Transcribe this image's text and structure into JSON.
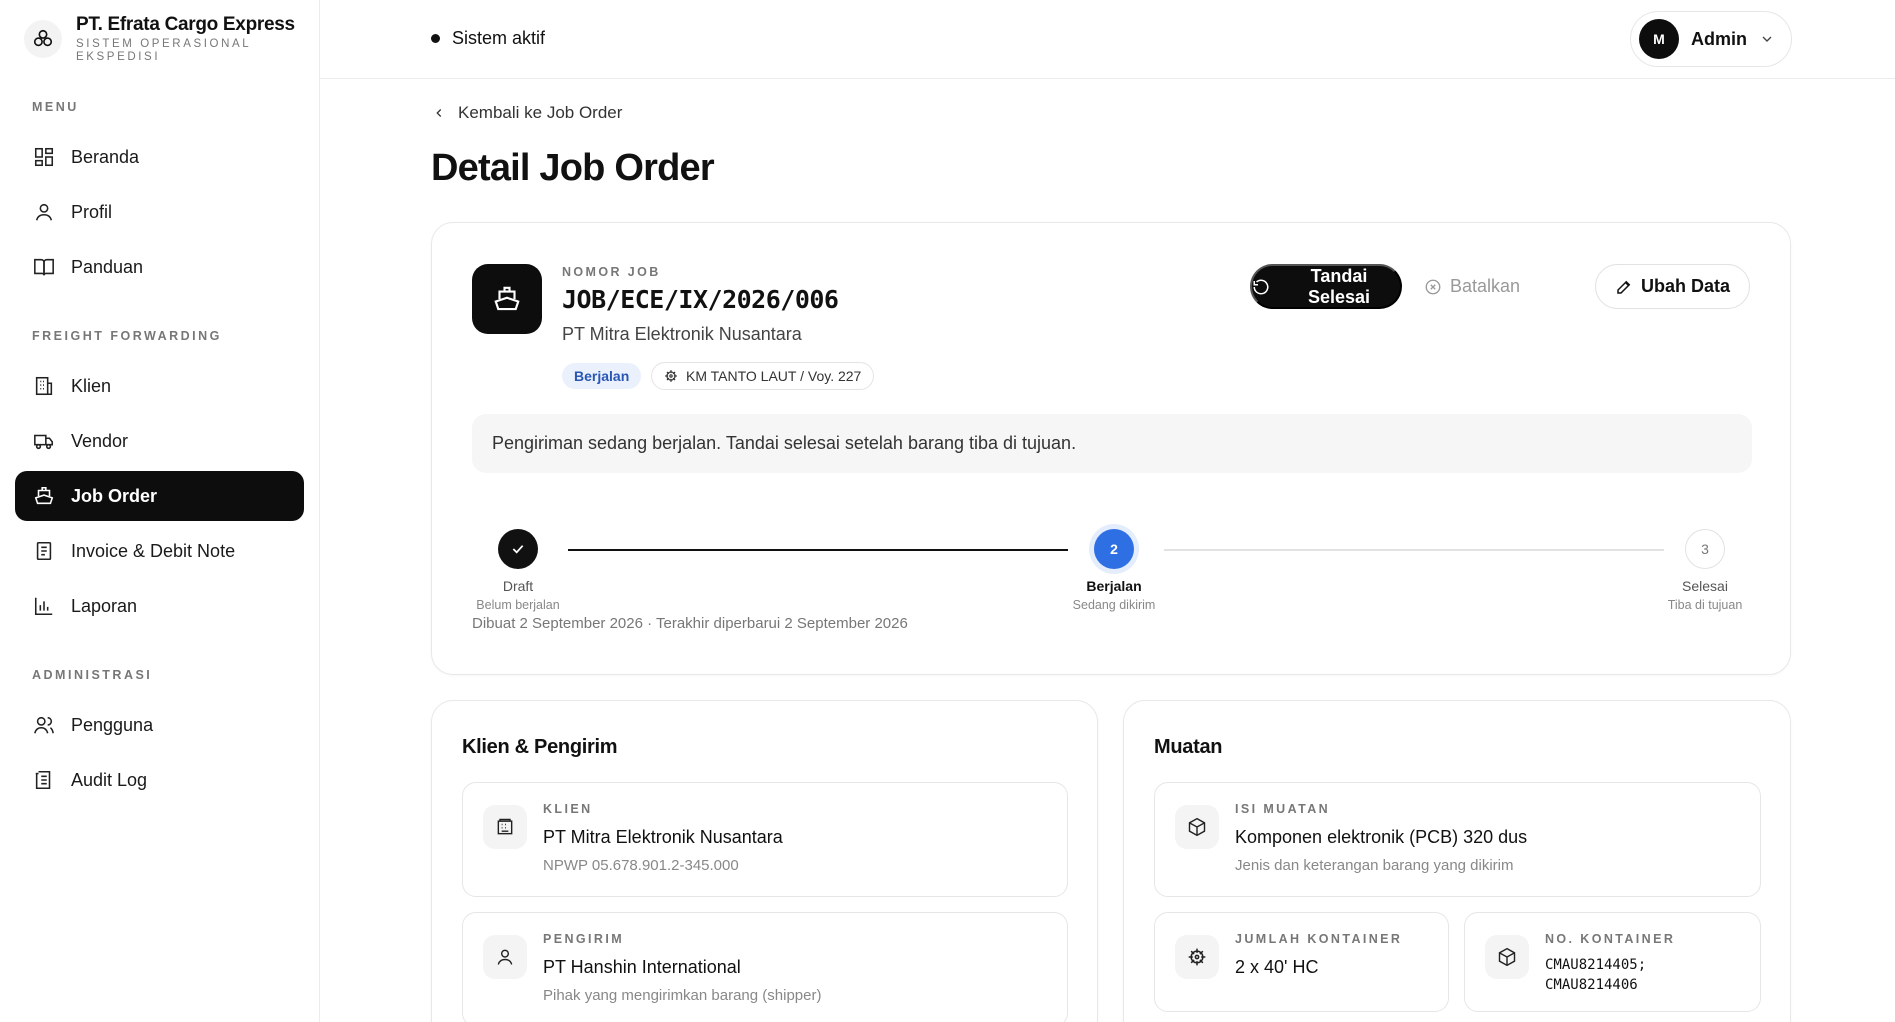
{
  "brand": {
    "name": "PT. Efrata Cargo Express",
    "subtitle": "SISTEM OPERASIONAL EKSPEDISI"
  },
  "sidebar": {
    "sections": [
      {
        "label": "MENU"
      },
      {
        "label": "FREIGHT FORWARDING"
      },
      {
        "label": "ADMINISTRASI"
      }
    ],
    "items": [
      {
        "label": "Beranda",
        "icon": "dashboard-icon"
      },
      {
        "label": "Profil",
        "icon": "user-icon"
      },
      {
        "label": "Panduan",
        "icon": "book-icon"
      },
      {
        "label": "Klien",
        "icon": "building-icon"
      },
      {
        "label": "Vendor",
        "icon": "truck-icon"
      },
      {
        "label": "Job Order",
        "icon": "ship-icon",
        "active": true
      },
      {
        "label": "Invoice & Debit Note",
        "icon": "document-icon"
      },
      {
        "label": "Laporan",
        "icon": "chart-icon"
      },
      {
        "label": "Pengguna",
        "icon": "users-icon"
      },
      {
        "label": "Audit Log",
        "icon": "log-icon"
      }
    ]
  },
  "topbar": {
    "status": "Sistem aktif",
    "user": {
      "initial": "M",
      "name": "Admin"
    }
  },
  "page": {
    "back_label": "Kembali ke Job Order",
    "title": "Detail Job Order"
  },
  "job": {
    "number_label": "NOMOR JOB",
    "number": "JOB/ECE/IX/2026/006",
    "client": "PT Mitra Elektronik Nusantara",
    "status_badge": "Berjalan",
    "vessel": "KM TANTO LAUT / Voy. 227",
    "actions": {
      "complete": "Tandai Selesai",
      "cancel": "Batalkan",
      "edit": "Ubah Data"
    },
    "notice": "Pengiriman sedang berjalan. Tandai selesai setelah barang tiba di tujuan.",
    "steps": [
      {
        "number": "1",
        "title": "Draft",
        "subtitle": "Belum berjalan",
        "state": "done"
      },
      {
        "number": "2",
        "title": "Berjalan",
        "subtitle": "Sedang dikirim",
        "state": "current"
      },
      {
        "number": "3",
        "title": "Selesai",
        "subtitle": "Tiba di tujuan",
        "state": "pending"
      }
    ],
    "meta": "Dibuat 2 September 2026 · Terakhir diperbarui 2 September 2026"
  },
  "client_section": {
    "title": "Klien & Pengirim",
    "client": {
      "label": "KLIEN",
      "value": "PT Mitra Elektronik Nusantara",
      "sub": "NPWP 05.678.901.2-345.000"
    },
    "shipper": {
      "label": "PENGIRIM",
      "value": "PT Hanshin International",
      "sub": "Pihak yang mengirimkan barang (shipper)"
    }
  },
  "cargo_section": {
    "title": "Muatan",
    "content": {
      "label": "ISI MUATAN",
      "value": "Komponen elektronik (PCB) 320 dus",
      "sub": "Jenis dan keterangan barang yang dikirim"
    },
    "container_count": {
      "label": "JUMLAH KONTAINER",
      "value": "2 x 40' HC"
    },
    "container_no": {
      "label": "NO. KONTAINER",
      "value_line1": "CMAU8214405;",
      "value_line2": "CMAU8214406"
    }
  },
  "colors": {
    "accent": "#0d0d0d",
    "current_step": "#2f6fe4",
    "status_badge_bg": "#eaf1fc",
    "status_badge_text": "#2957b5"
  }
}
